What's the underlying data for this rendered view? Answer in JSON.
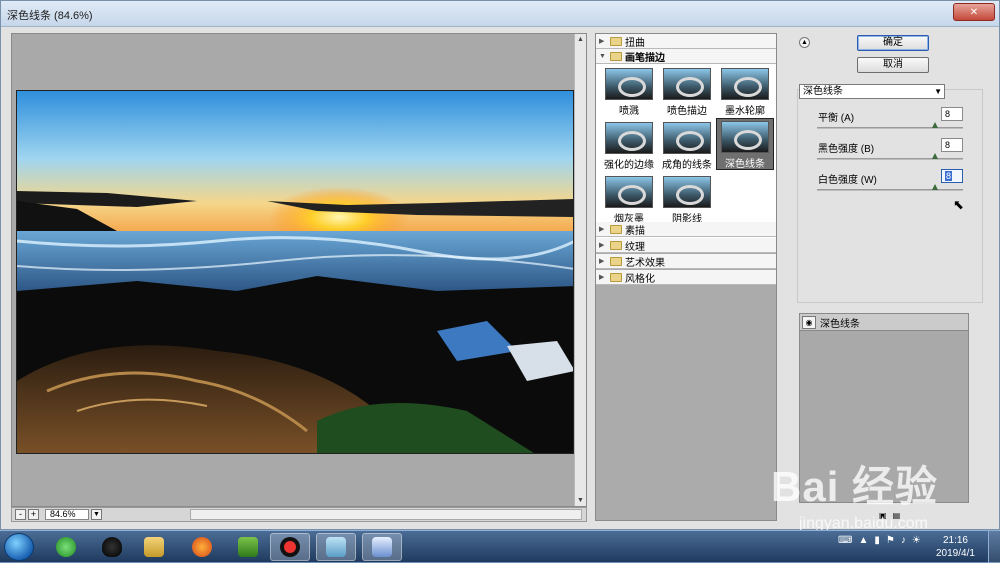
{
  "window": {
    "title": "深色线条 (84.6%)"
  },
  "zoom": {
    "value": "84.6%",
    "minus": "-",
    "plus": "+"
  },
  "gallery": {
    "categories": [
      {
        "label": "扭曲",
        "open": false
      },
      {
        "label": "画笔描边",
        "open": true
      },
      {
        "label": "素描",
        "open": false
      },
      {
        "label": "纹理",
        "open": false
      },
      {
        "label": "艺术效果",
        "open": false
      },
      {
        "label": "风格化",
        "open": false
      }
    ],
    "thumbnails": [
      "喷溅",
      "喷色描边",
      "墨水轮廓",
      "强化的边缘",
      "成角的线条",
      "深色线条",
      "烟灰墨",
      "阴影线"
    ],
    "selected": "深色线条"
  },
  "buttons": {
    "ok": "确定",
    "cancel": "取消"
  },
  "filter_select": "深色线条",
  "params": [
    {
      "label": "平衡",
      "key": "(A)",
      "value": "8",
      "fraction": 0.8
    },
    {
      "label": "黑色强度",
      "key": "(B)",
      "value": "8",
      "fraction": 0.8
    },
    {
      "label": "白色强度",
      "key": "(W)",
      "value": "8",
      "fraction": 0.8
    }
  ],
  "layers": [
    {
      "name": "深色线条",
      "visible": true
    }
  ],
  "watermark": {
    "brand": "Bai 经验",
    "url": "jingyan.baidu.com"
  },
  "taskbar": {
    "clock_time": "21:16",
    "clock_date": "2019/4/1",
    "apps": [
      "browser-360-icon",
      "qq-icon",
      "explorer-icon",
      "firefox-icon",
      "media-player-icon",
      "recorder-icon",
      "app-icon",
      "photoshop-icon"
    ]
  }
}
